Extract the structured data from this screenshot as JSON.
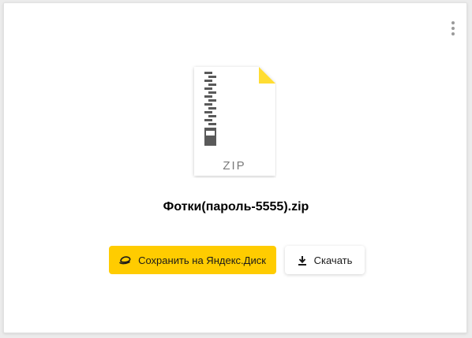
{
  "menu": {
    "icon": "more-vertical-icon"
  },
  "file": {
    "name": "Фотки(пароль-5555).zip",
    "type_label": "ZIP",
    "icon": "zip-file-icon",
    "corner_color": "#ffdd33"
  },
  "actions": {
    "save_label": "Сохранить на Яндекс.Диск",
    "save_icon": "yandex-disk-icon",
    "download_label": "Скачать",
    "download_icon": "download-icon",
    "accent_color": "#ffcc00"
  }
}
